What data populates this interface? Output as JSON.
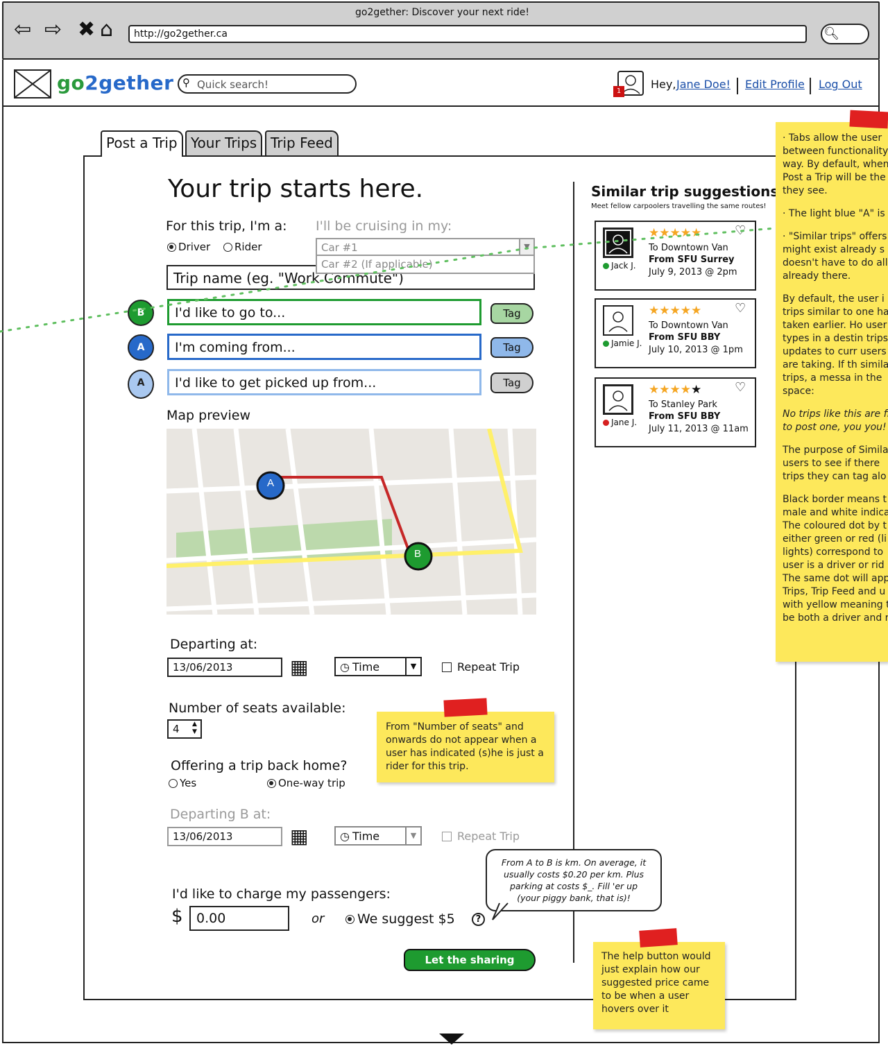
{
  "browser": {
    "title": "go2gether: Discover your next ride!",
    "url": "http://go2gether.ca",
    "nav": [
      "back-icon",
      "forward-icon",
      "close-icon",
      "home-icon",
      "search-icon"
    ]
  },
  "header": {
    "app_name_go": "go",
    "app_name_2": "2",
    "app_name_gether": "gether",
    "search_placeholder": "Quick search!",
    "notification_count": "1",
    "greeting": "Hey,",
    "user_name": "Jane Doe!",
    "edit_profile": "Edit Profile",
    "log_out": "Log Out"
  },
  "tabs": [
    {
      "label": "Post a Trip",
      "active": true
    },
    {
      "label": "Your Trips",
      "active": false
    },
    {
      "label": "Trip Feed",
      "active": false
    }
  ],
  "form": {
    "hero": "Your trip starts here.",
    "role_label": "For this trip, I'm a:",
    "role_options": [
      "Driver",
      "Rider"
    ],
    "role_selected": "Driver",
    "vehicle_label": "I'll be cruising in my:",
    "vehicle_options": [
      "Car #1",
      "Car #2 (If applicable)"
    ],
    "trip_name_placeholder": "Trip name (eg. \"Work Commute\")",
    "destination_placeholder": "I'd like to go to...",
    "origin_placeholder": "I'm coming from...",
    "pickup_placeholder": "I'd like to get picked up from...",
    "pin_b": "B",
    "pin_a": "A",
    "pin_pickup": "A",
    "tag_label": "Tag",
    "map_label": "Map preview",
    "map_marker_a": "A",
    "map_marker_b": "B",
    "depart_label": "Departing at:",
    "depart_date": "13/06/2013",
    "time_label": "Time",
    "repeat_label": "Repeat Trip",
    "seats_label": "Number of seats available:",
    "seats_value": "4",
    "return_label": "Offering a trip back home?",
    "return_options": [
      "Yes",
      "One-way trip"
    ],
    "return_selected": "One-way trip",
    "depart_b_label": "Departing B at:",
    "depart_b_date": "13/06/2013",
    "charge_label": "I'd like to charge my passengers:",
    "currency": "$",
    "charge_value": "0.00",
    "or": "or",
    "suggest_label": "We suggest $5",
    "help_icon": "?",
    "submit": "Let the sharing begin!"
  },
  "bubble": {
    "line1": "From A to B is km. On average, it",
    "line2": "usually costs $0.20 per km. Plus",
    "line3": "parking at  costs $_. Fill 'er up",
    "line4": "(your piggy bank, that is)!"
  },
  "suggestions": {
    "title": "Similar trip suggestions",
    "subtitle": "Meet fellow carpoolers travelling the same routes!",
    "cards": [
      {
        "name": "Jack J.",
        "destination": "To Downtown Van",
        "origin": "From SFU Surrey",
        "date": "July 9, 2013 @ 2pm",
        "rating": 5,
        "status_color": "#1e9b30"
      },
      {
        "name": "Jamie J.",
        "destination": "To Downtown Van",
        "origin": "From SFU BBY",
        "date": "July 10, 2013 @ 1pm",
        "rating": 5,
        "status_color": "#1e9b30"
      },
      {
        "name": "Jane J.",
        "destination": "To Stanley Park",
        "origin": "From SFU BBY",
        "date": "July 11, 2013 @ 11am",
        "rating": 4,
        "status_color": "#d62020"
      }
    ]
  },
  "notes": {
    "right": [
      "· Tabs allow the user between functionality way. By default, when Post a Trip will be the they see.",
      "· The light blue \"A\" is",
      "· \"Similar trips\" offers might exist already s doesn't have to do all already there.",
      "By default, the user i of trips similar to one have taken earlier. Ho user types in a destin trips\" updates to curr users are taking. If th similar trips, a messa in the space:",
      "No trips like this are first to post one, you you!",
      "The purpose of Simila users to see if there trips they can tag alo",
      "Black border means t male and white indica The coloured dot by t either green or red (li lights) correspond to user is a driver or rid The same dot will app Trips, Trip Feed and u with yellow meaning t be both a driver and r"
    ],
    "seats": "From \"Number of seats\" and onwards do not appear when a user has indicated (s)he is just a rider for this trip.",
    "help": "The help button would just explain how our suggested price came to be when a user hovers over it"
  },
  "colors": {
    "brand_green": "#2a9a3c",
    "destination_green": "#1e9b30",
    "origin_blue": "#2769c9",
    "pickup_blue": "#8fb8ea",
    "link_blue": "#1b4fa8",
    "sticky_yellow": "#fde85b",
    "route_red": "#c62828"
  }
}
